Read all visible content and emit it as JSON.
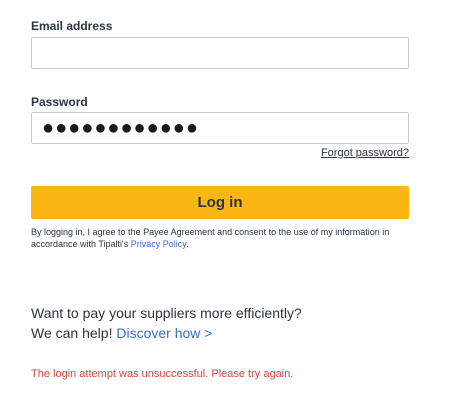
{
  "form": {
    "email_label": "Email address",
    "email_value": "",
    "password_label": "Password",
    "password_masked": "●●●●●●●●●●●●",
    "forgot_password": "Forgot password?",
    "login_button": "Log in"
  },
  "consent": {
    "prefix": "By logging in, I agree to the ",
    "payee_agreement": "Payee Agreement",
    "middle": " and consent to the use of my information in accordance with Tipalti's ",
    "privacy_policy": "Privacy Policy",
    "suffix": "."
  },
  "promo": {
    "line1": "Want to pay your suppliers more efficiently?",
    "line2_prefix": "We can help! ",
    "discover_link": "Discover how >"
  },
  "error": {
    "message": "The login attempt was unsuccessful. Please try again."
  },
  "colors": {
    "accent_button": "#fbb613",
    "link_blue": "#3a6ec8",
    "error_red": "#d64545",
    "text": "#2b3440"
  }
}
